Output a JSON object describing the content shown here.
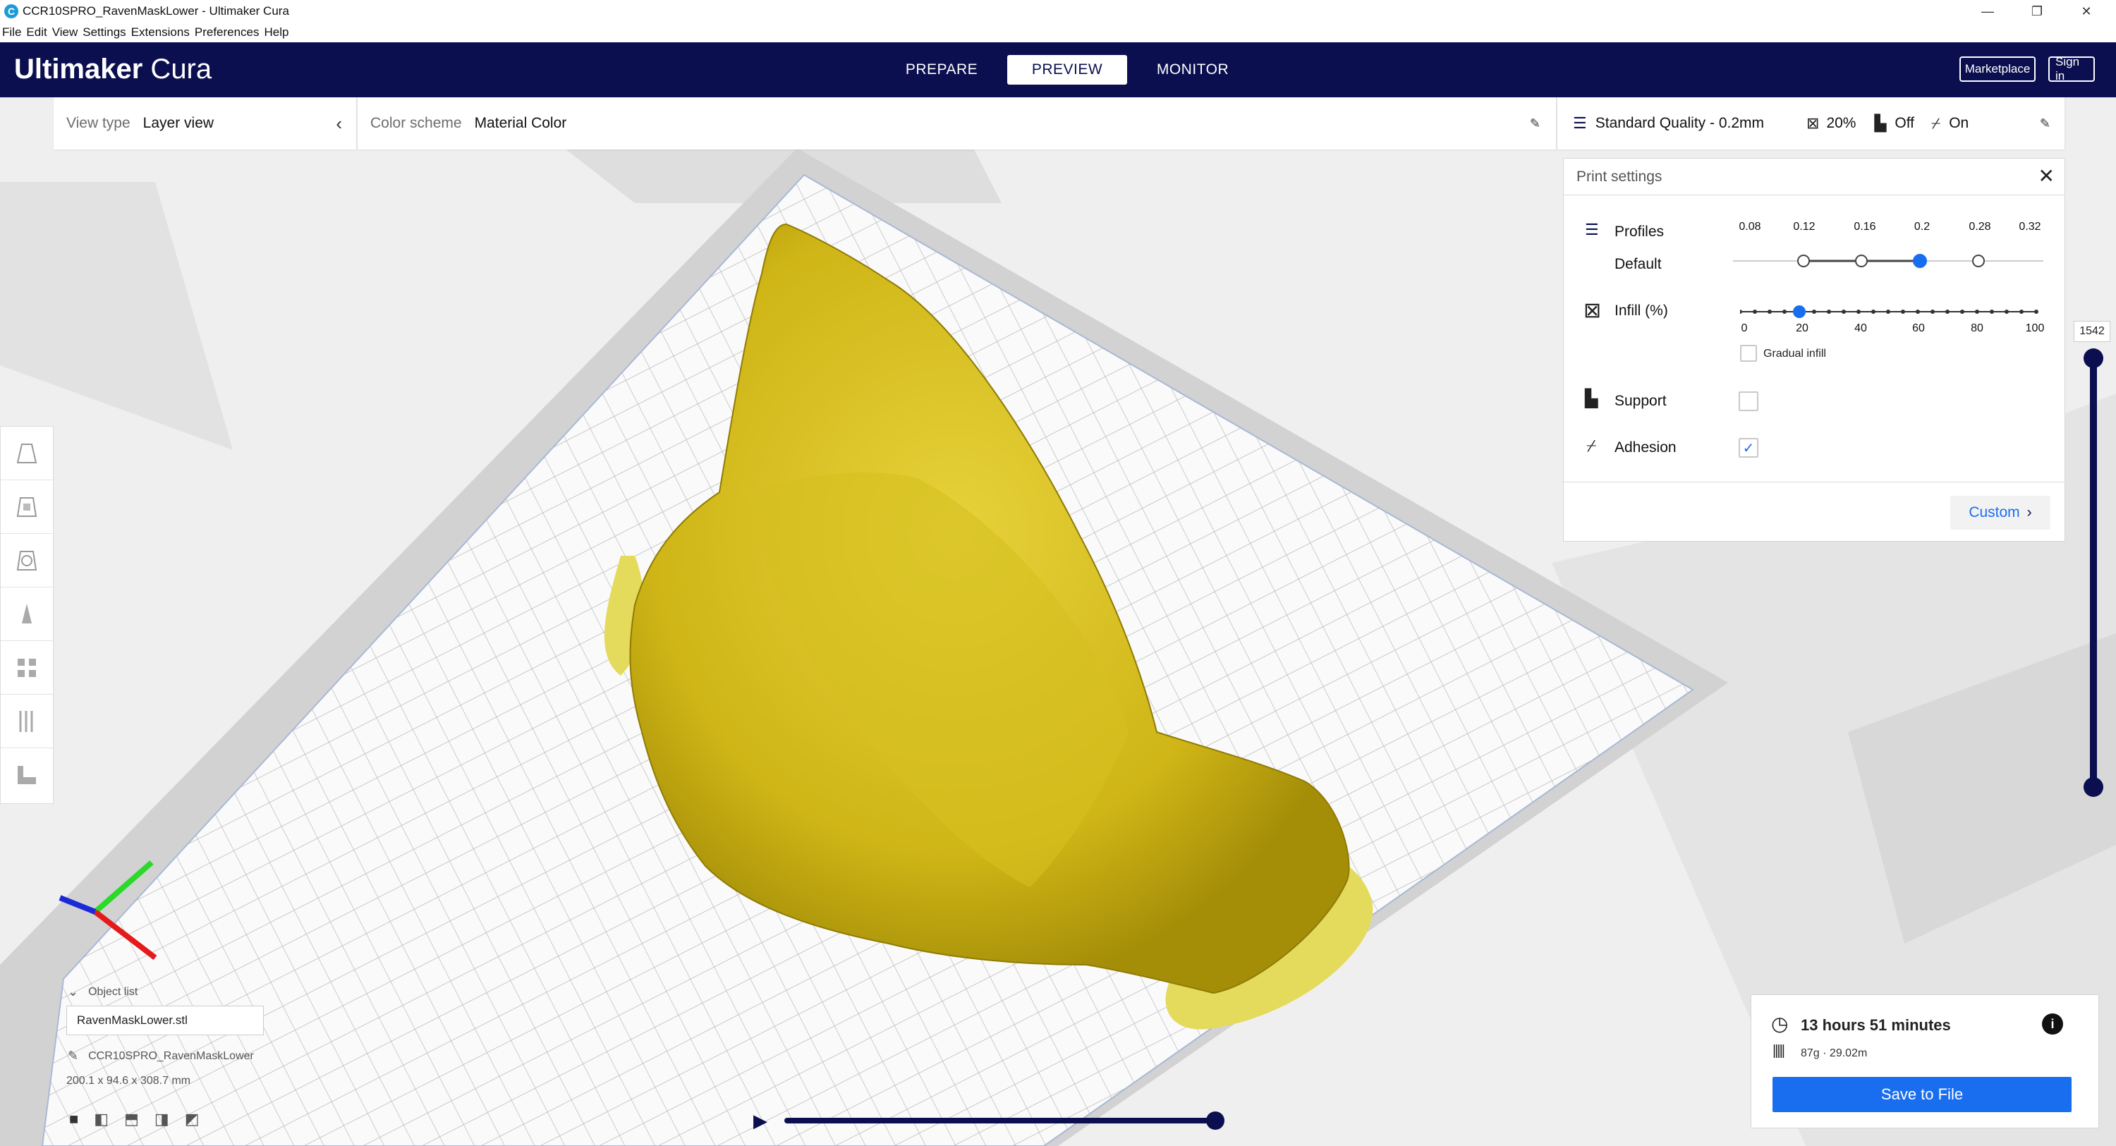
{
  "window": {
    "title": "CCR10SPRO_RavenMaskLower - Ultimaker Cura",
    "app_icon": "C",
    "controls": [
      "—",
      "❐",
      "✕"
    ]
  },
  "menu": [
    "File",
    "Edit",
    "View",
    "Settings",
    "Extensions",
    "Preferences",
    "Help"
  ],
  "header": {
    "logo_bold": "Ultimaker",
    "logo_light": " Cura",
    "tabs": [
      "PREPARE",
      "PREVIEW",
      "MONITOR"
    ],
    "active_tab": "PREVIEW",
    "marketplace": "Marketplace",
    "signin": "Sign in"
  },
  "view_type": {
    "label": "View type",
    "value": "Layer view"
  },
  "color_scheme": {
    "label": "Color scheme",
    "value": "Material Color"
  },
  "quality_bar": {
    "profile": "Standard Quality - 0.2mm",
    "infill": "20%",
    "support": "Off",
    "adhesion": "On"
  },
  "print_settings": {
    "title": "Print settings",
    "profiles_label": "Profiles",
    "profiles_sub": "Default",
    "profile_ticks": [
      "0.08",
      "0.12",
      "0.16",
      "0.2",
      "0.28",
      "0.32"
    ],
    "profile_selected": "0.2",
    "infill_label": "Infill (%)",
    "infill_ticks": [
      "0",
      "20",
      "40",
      "60",
      "80",
      "100"
    ],
    "infill_value": 20,
    "gradual_infill": "Gradual infill",
    "support_label": "Support",
    "support_checked": false,
    "adhesion_label": "Adhesion",
    "adhesion_checked": true,
    "custom_button": "Custom"
  },
  "layer_slider": {
    "max_layer": "1542"
  },
  "object_list": {
    "toggle": "Object list",
    "file": "RavenMaskLower.stl",
    "job_name": "CCR10SPRO_RavenMaskLower",
    "dimensions": "200.1 x 94.6 x 308.7 mm"
  },
  "print_info": {
    "time": "13 hours 51 minutes",
    "material": "87g · 29.02m",
    "save_button": "Save to File"
  },
  "colors": {
    "header": "#0b0f4f",
    "accent": "#196ef0",
    "model": "#d9c21a"
  }
}
